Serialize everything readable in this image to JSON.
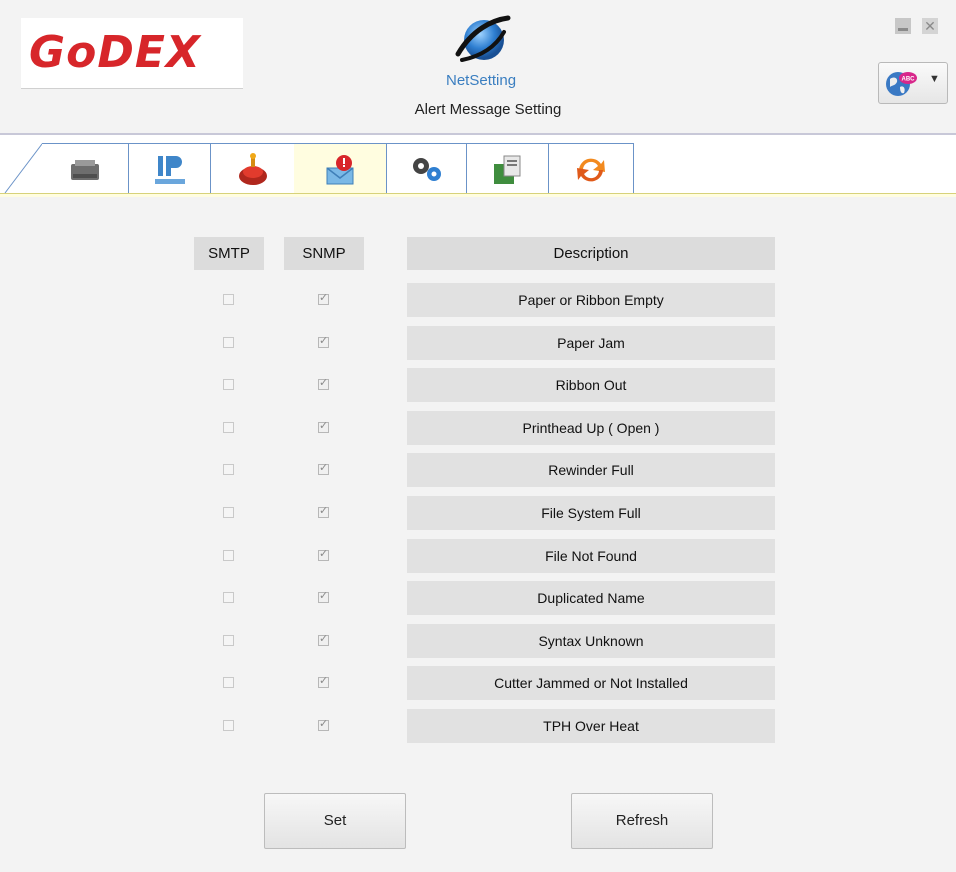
{
  "app": {
    "brand": "GoDEX",
    "module_name": "NetSetting",
    "page_title": "Alert Message Setting"
  },
  "tabs": [
    {
      "icon": "printer-icon",
      "active": false
    },
    {
      "icon": "ip-network-icon",
      "active": false
    },
    {
      "icon": "alarm-icon",
      "active": false
    },
    {
      "icon": "alert-message-icon",
      "active": true
    },
    {
      "icon": "settings-gears-icon",
      "active": false
    },
    {
      "icon": "java-icon",
      "active": false
    },
    {
      "icon": "refresh-arrows-icon",
      "active": false
    }
  ],
  "table": {
    "headers": {
      "smtp": "SMTP",
      "snmp": "SNMP",
      "description": "Description"
    },
    "rows": [
      {
        "smtp": false,
        "snmp": true,
        "description": "Paper or Ribbon Empty"
      },
      {
        "smtp": false,
        "snmp": true,
        "description": "Paper Jam"
      },
      {
        "smtp": false,
        "snmp": true,
        "description": "Ribbon Out"
      },
      {
        "smtp": false,
        "snmp": true,
        "description": "Printhead Up ( Open )"
      },
      {
        "smtp": false,
        "snmp": true,
        "description": "Rewinder Full"
      },
      {
        "smtp": false,
        "snmp": true,
        "description": "File System Full"
      },
      {
        "smtp": false,
        "snmp": true,
        "description": "File Not Found"
      },
      {
        "smtp": false,
        "snmp": true,
        "description": "Duplicated Name"
      },
      {
        "smtp": false,
        "snmp": true,
        "description": "Syntax Unknown"
      },
      {
        "smtp": false,
        "snmp": true,
        "description": "Cutter Jammed or Not Installed"
      },
      {
        "smtp": false,
        "snmp": true,
        "description": "TPH Over Heat"
      }
    ]
  },
  "buttons": {
    "set": "Set",
    "refresh": "Refresh"
  },
  "language_badge": "ABC",
  "colors": {
    "brand_red": "#d7262a",
    "tab_border": "#6b93c8",
    "active_tab": "#fffde0"
  }
}
